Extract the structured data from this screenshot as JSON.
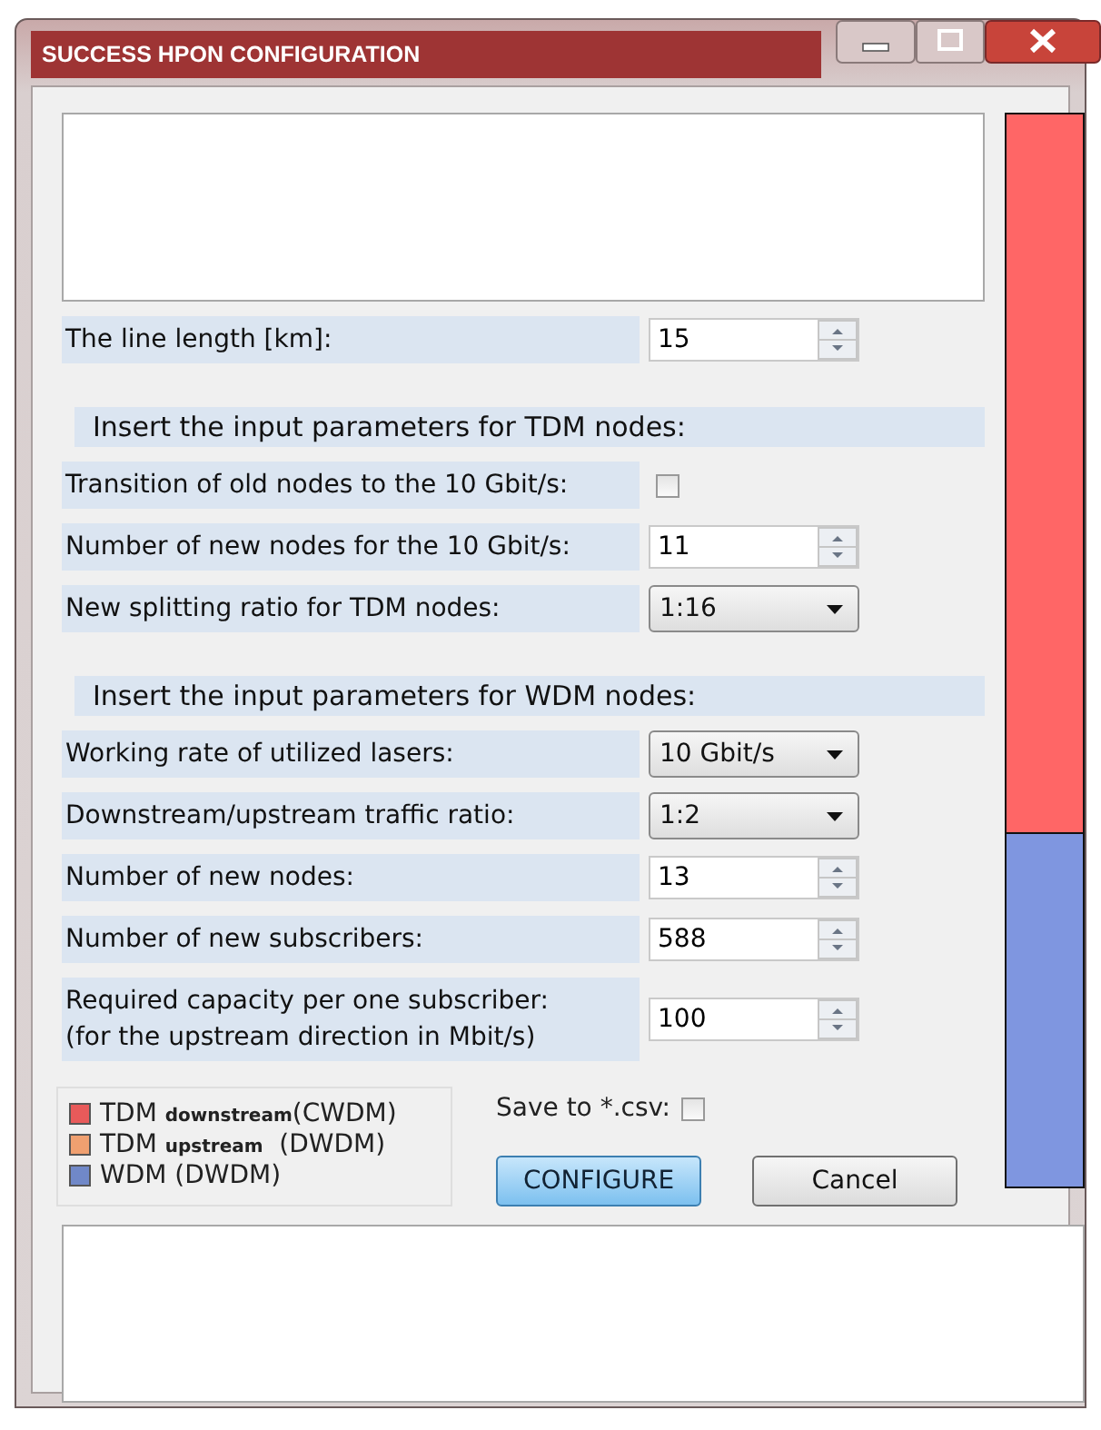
{
  "window": {
    "title": "SUCCESS HPON CONFIGURATION"
  },
  "rows": [
    {
      "kind": "spin",
      "label": "The line length [km]:",
      "value": "15"
    },
    {
      "kind": "heading",
      "label": "Insert the input parameters for TDM nodes:"
    },
    {
      "kind": "checkbox",
      "label": "Transition of old nodes to the 10 Gbit/s:",
      "checked": false
    },
    {
      "kind": "spin",
      "label": "Number of new nodes for the 10 Gbit/s:",
      "value": "11"
    },
    {
      "kind": "dropdown",
      "label": "New splitting ratio for TDM nodes:",
      "value": "1:16"
    },
    {
      "kind": "heading",
      "label": "Insert the input parameters for WDM nodes:"
    },
    {
      "kind": "dropdown",
      "label": "Working rate of utilized lasers:",
      "value": "10 Gbit/s"
    },
    {
      "kind": "dropdown",
      "label": "Downstream/upstream traffic ratio:",
      "value": "1:2"
    },
    {
      "kind": "spin",
      "label": "Number of new nodes:",
      "value": "13"
    },
    {
      "kind": "spin",
      "label": "Number of new subscribers:",
      "value": "588"
    },
    {
      "kind": "spin",
      "label": "Required capacity per one subscriber:\n(for the upstream direction in Mbit/s)",
      "value": "100"
    }
  ],
  "legend": [
    {
      "label": "TDM **downstream**(CWDM)",
      "color": "#e85a5a"
    },
    {
      "label": "TDM **upstream**  (DWDM)",
      "color": "#f0a070"
    },
    {
      "label": "WDM (DWDM)",
      "color": "#7088c8"
    }
  ],
  "save_csv": {
    "label": "Save to *.csv:",
    "checked": false
  },
  "buttons": [
    {
      "label": "CONFIGURE",
      "kind": "primary"
    },
    {
      "label": "Cancel",
      "kind": "normal"
    }
  ],
  "bar": {
    "segments": [
      {
        "color": "#ff6666",
        "level": 0.67
      },
      {
        "color": "#7f96e0",
        "level": 0.33
      }
    ]
  }
}
